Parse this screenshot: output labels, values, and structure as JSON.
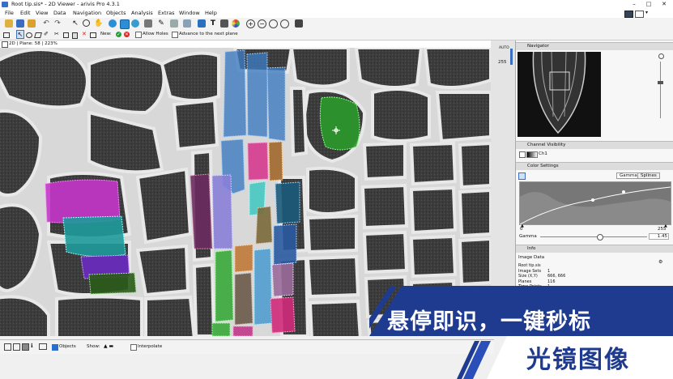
{
  "window": {
    "title": "Root tip.sis* - 2D Viewer - arivis Pro 4.3.1",
    "controls": [
      "–",
      "□",
      "✕"
    ]
  },
  "menu": [
    "File",
    "Edit",
    "View",
    "Data",
    "Navigation",
    "Objects",
    "Analysis",
    "Extras",
    "Window",
    "Help"
  ],
  "toolbar2": {
    "new_label": "New:",
    "allow_holes": "Allow Holes",
    "advance_label": "Advance to the next plane"
  },
  "viewer": {
    "status": "2D | Plane: 58 | 223%",
    "range_top": "AUTO",
    "range_value": "255"
  },
  "bottom_bar": {
    "objects_label": "Objects",
    "show_label": "Show:",
    "interpolate_label": "Interpolate"
  },
  "panel": {
    "navigator_title": "Navigator",
    "channel_visibility_title": "Channel Visibility",
    "channel_name": "Ch1",
    "color_settings_title": "Color Settings",
    "tab_gamma": "Gamma",
    "tab_splines": "Splines",
    "axis_min": "0",
    "axis_max": "255",
    "gamma_label": "Gamma",
    "gamma_value": "1.45",
    "gamma_fraction": 0.55,
    "info_title": "Info",
    "image_data_title": "Image Data",
    "info_rows": [
      {
        "k": "Root tip.sis",
        "v": ""
      },
      {
        "k": "Image Sets",
        "v": "1"
      },
      {
        "k": "Size (X,Y)",
        "v": "666, 666"
      },
      {
        "k": "Planes",
        "v": "116"
      },
      {
        "k": "Time Points",
        "v": "1"
      }
    ]
  },
  "banner": {
    "line1": "悬停即识，一键秒标",
    "line2": "光镜图像",
    "colors": {
      "band": "#1f3b8f",
      "white": "#ffffff",
      "accent": "#2a4fb8"
    }
  }
}
